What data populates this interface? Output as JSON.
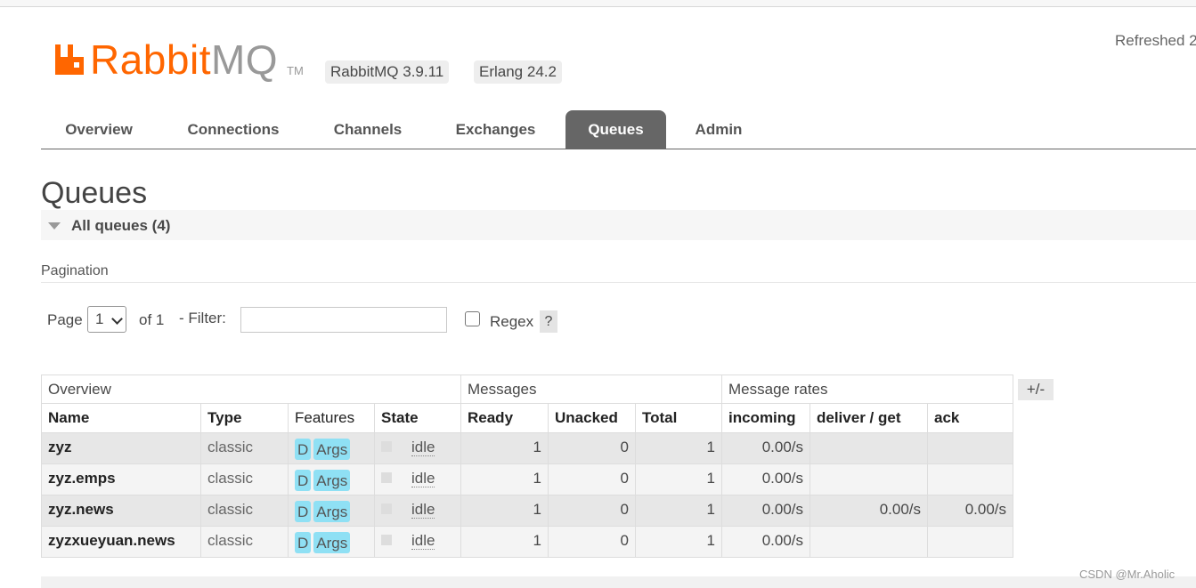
{
  "header": {
    "logo_main": "Rabbit",
    "logo_mq": "MQ",
    "logo_tm": "TM",
    "version_rabbit": "RabbitMQ 3.9.11",
    "version_erlang": "Erlang 24.2",
    "refreshed": "Refreshed 2"
  },
  "nav": {
    "tabs": [
      "Overview",
      "Connections",
      "Channels",
      "Exchanges",
      "Queues",
      "Admin"
    ],
    "active": "Queues"
  },
  "page": {
    "title": "Queues",
    "section_title": "All queues (4)"
  },
  "pagination": {
    "label": "Pagination",
    "page_label": "Page",
    "page_value": "1",
    "of_label": "of 1",
    "filter_label": "- Filter:",
    "filter_value": "",
    "regex_label": "Regex",
    "help": "?"
  },
  "table": {
    "groups": [
      "Overview",
      "Messages",
      "Message rates"
    ],
    "columns": [
      "Name",
      "Type",
      "Features",
      "State",
      "Ready",
      "Unacked",
      "Total",
      "incoming",
      "deliver / get",
      "ack"
    ],
    "plus_minus": "+/-",
    "rows": [
      {
        "name": "zyz",
        "type": "classic",
        "f1": "D",
        "f2": "Args",
        "state": "idle",
        "ready": "1",
        "unacked": "0",
        "total": "1",
        "incoming": "0.00/s",
        "deliver": "",
        "ack": ""
      },
      {
        "name": "zyz.emps",
        "type": "classic",
        "f1": "D",
        "f2": "Args",
        "state": "idle",
        "ready": "1",
        "unacked": "0",
        "total": "1",
        "incoming": "0.00/s",
        "deliver": "",
        "ack": ""
      },
      {
        "name": "zyz.news",
        "type": "classic",
        "f1": "D",
        "f2": "Args",
        "state": "idle",
        "ready": "1",
        "unacked": "0",
        "total": "1",
        "incoming": "0.00/s",
        "deliver": "0.00/s",
        "ack": "0.00/s"
      },
      {
        "name": "zyzxueyuan.news",
        "type": "classic",
        "f1": "D",
        "f2": "Args",
        "state": "idle",
        "ready": "1",
        "unacked": "0",
        "total": "1",
        "incoming": "0.00/s",
        "deliver": "",
        "ack": ""
      }
    ]
  },
  "footer": {
    "watermark": "CSDN @Mr.Aholic"
  },
  "colors": {
    "brand_orange": "#ff6600",
    "tab_active": "#666666",
    "badge": "#8fe0f4"
  }
}
